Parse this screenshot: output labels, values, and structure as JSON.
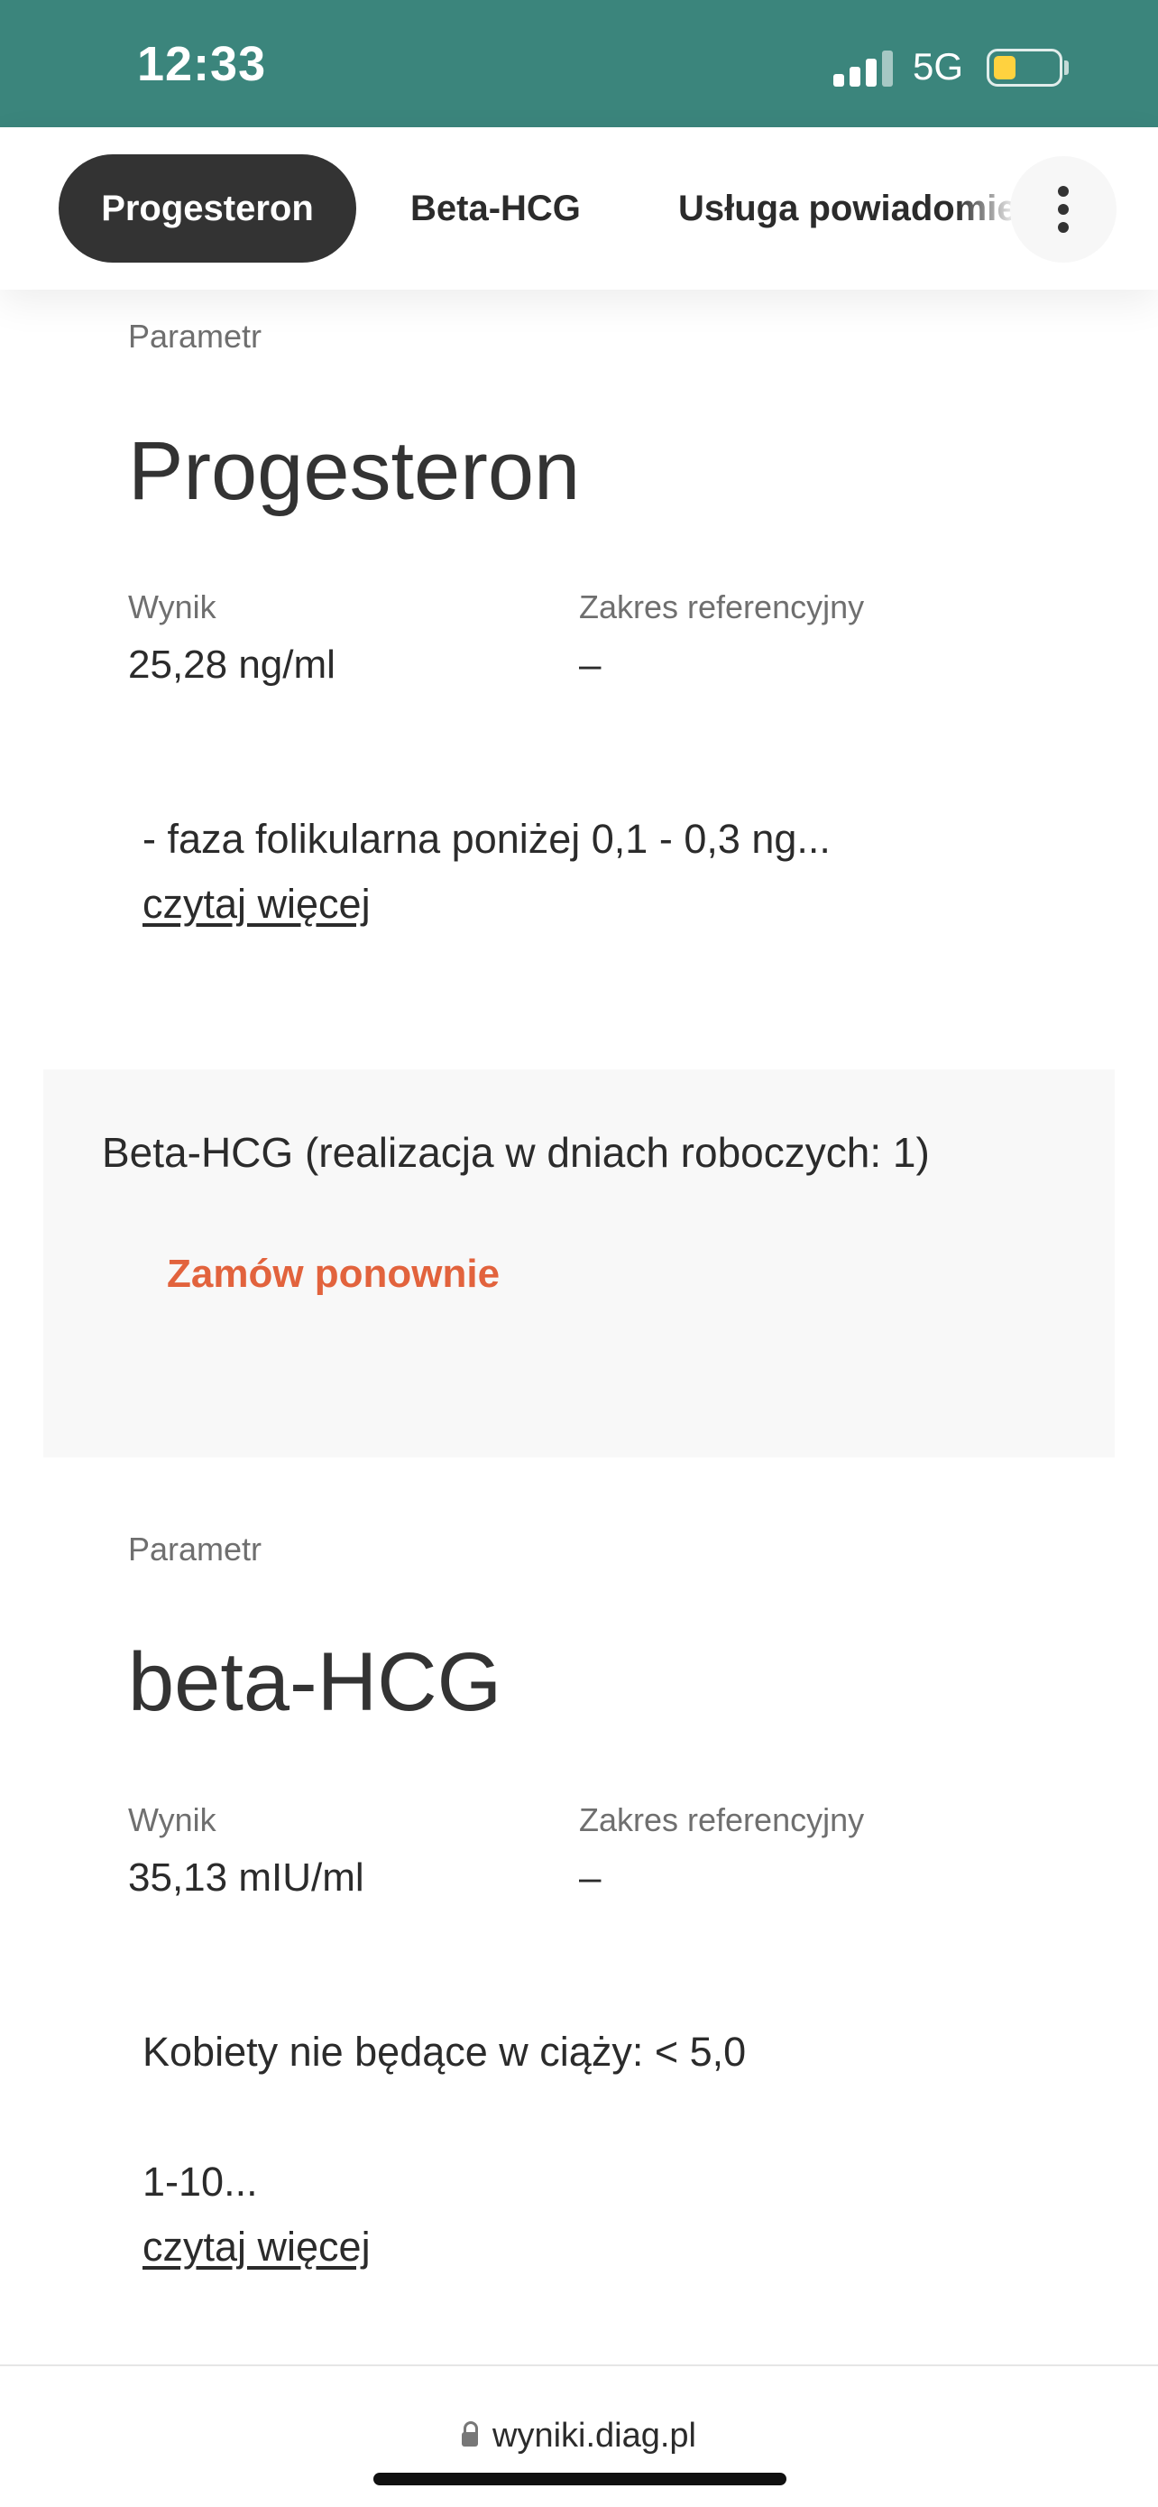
{
  "status_bar": {
    "time": "12:33",
    "network": "5G",
    "icons": [
      "signal-icon",
      "battery-icon"
    ],
    "battery_color": "#ffd23f"
  },
  "tabs": [
    {
      "label": "Progesteron",
      "active": true
    },
    {
      "label": "Beta-HCG",
      "active": false
    },
    {
      "label": "Usługa powiadomie",
      "active": false
    }
  ],
  "menu_icon": "more-vertical-icon",
  "progesteron": {
    "param_label": "Parametr",
    "name": "Progesteron",
    "result_label": "Wynik",
    "result_value": "25,28 ng/ml",
    "ref_label": "Zakres referencyjny",
    "ref_value": "–",
    "description": "- faza folikularna poniżej 0,1 - 0,3 ng...",
    "read_more": "czytaj więcej"
  },
  "beta_section": {
    "title": "Beta-HCG (realizacja w dniach roboczych: 1)",
    "reorder": "Zamów ponownie"
  },
  "beta_hcg": {
    "param_label": "Parametr",
    "name": "beta-HCG",
    "result_label": "Wynik",
    "result_value": "35,13 mIU/ml",
    "ref_label": "Zakres referencyjny",
    "ref_value": "–",
    "description_line1": "Kobiety nie będące w ciąży: < 5,0",
    "description_line2": "1-10...",
    "read_more": "czytaj więcej"
  },
  "url_bar": {
    "url": "wyniki.diag.pl",
    "icon": "lock-icon"
  },
  "colors": {
    "status_bar": "#3b857c",
    "active_tab": "#333333",
    "accent": "#e2633d",
    "section_bg": "#f8f8f8"
  }
}
